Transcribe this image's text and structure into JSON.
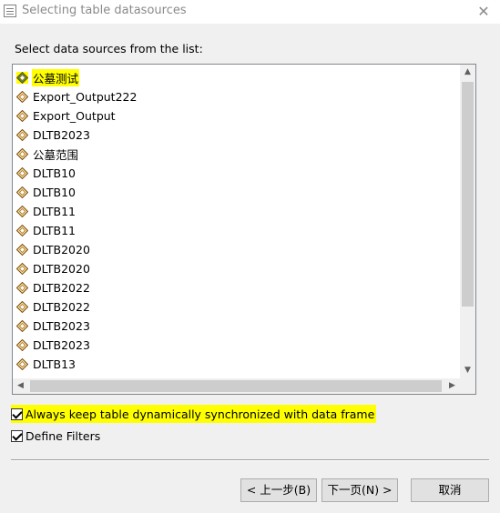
{
  "window": {
    "title": "Selecting table datasources",
    "close_glyph": "✕"
  },
  "prompt": "Select data sources from the list:",
  "list": {
    "items": [
      {
        "label": "公墓测试",
        "icon": "group-layer-icon",
        "highlighted": true
      },
      {
        "label": "Export_Output222",
        "icon": "feature-layer-icon"
      },
      {
        "label": "Export_Output",
        "icon": "feature-layer-icon"
      },
      {
        "label": "DLTB2023",
        "icon": "feature-layer-icon"
      },
      {
        "label": "公墓范围",
        "icon": "feature-layer-icon"
      },
      {
        "label": "DLTB10",
        "icon": "feature-layer-icon"
      },
      {
        "label": "DLTB10",
        "icon": "feature-layer-icon"
      },
      {
        "label": "DLTB11",
        "icon": "feature-layer-icon"
      },
      {
        "label": "DLTB11",
        "icon": "feature-layer-icon"
      },
      {
        "label": "DLTB2020",
        "icon": "feature-layer-icon"
      },
      {
        "label": "DLTB2020",
        "icon": "feature-layer-icon"
      },
      {
        "label": "DLTB2022",
        "icon": "feature-layer-icon"
      },
      {
        "label": "DLTB2022",
        "icon": "feature-layer-icon"
      },
      {
        "label": "DLTB2023",
        "icon": "feature-layer-icon"
      },
      {
        "label": "DLTB2023",
        "icon": "feature-layer-icon"
      },
      {
        "label": "DLTB13",
        "icon": "feature-layer-icon"
      }
    ]
  },
  "options": {
    "sync_label": "Always keep table dynamically synchronized with data frame",
    "sync_checked": true,
    "filters_label": "Define Filters",
    "filters_checked": true
  },
  "buttons": {
    "back": "< 上一步(B)",
    "next": "下一页(N) >",
    "cancel": "取消"
  },
  "colors": {
    "highlight": "#ffff00",
    "background": "#f0f0f0"
  }
}
